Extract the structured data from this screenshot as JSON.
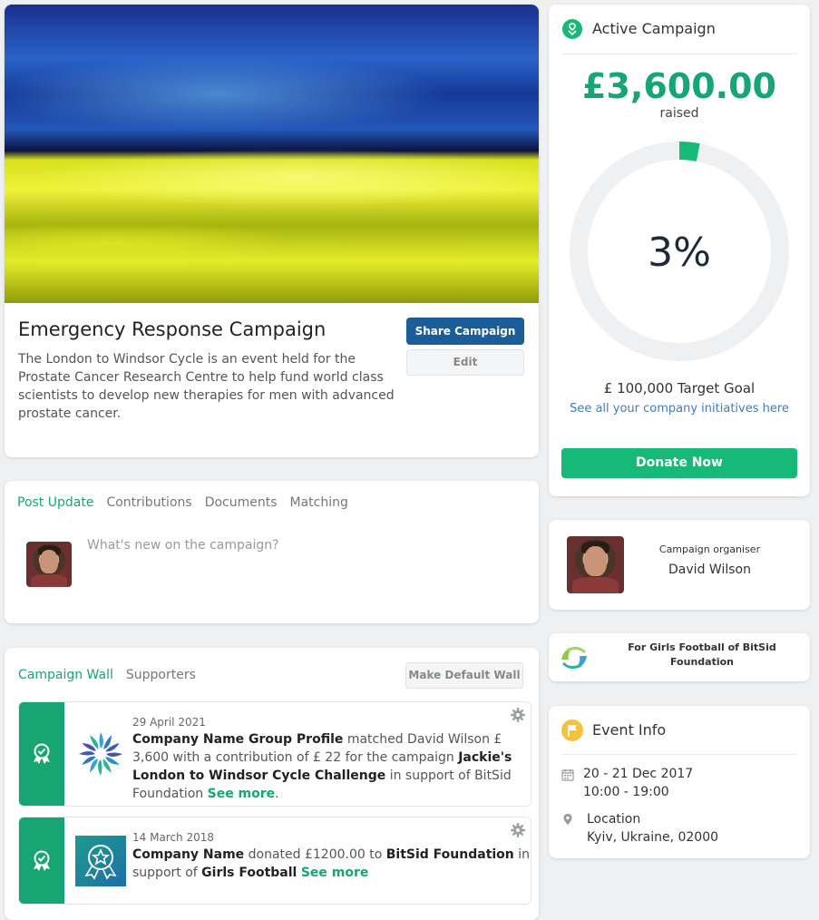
{
  "campaign": {
    "title": "Emergency Response Campaign",
    "description": "The London to Windsor Cycle is an event held for the Prostate Cancer Research Centre to help fund world class scientists to develop new therapies for men with advanced prostate cancer.",
    "share_label": "Share Campaign",
    "edit_label": "Edit"
  },
  "post": {
    "tabs": [
      "Post Update",
      "Contributions",
      "Documents",
      "Matching"
    ],
    "active_tab": "Post Update",
    "placeholder": "What's new on the campaign?"
  },
  "wall": {
    "tabs": [
      "Campaign Wall",
      "Supporters"
    ],
    "make_default_label": "Make Default Wall",
    "items": [
      {
        "date": "29 April 2021",
        "actor": "Company Name Group Profile",
        "t1": " matched David Wilson £ 3,600 with a contribution of £ 22 for the campaign ",
        "campaign": "Jackie's London to Windsor Cycle Challenge",
        "t2": " in support of BitSid Foundation ",
        "see_more": "See more",
        "t3": "."
      },
      {
        "date": "14 March 2018",
        "actor": "Company Name",
        "t1": " donated £1200.00 to ",
        "org": "BitSid Foundation",
        "t2": " in support of ",
        "cause": "Girls Football",
        "see_more": "See more"
      }
    ]
  },
  "active_campaign": {
    "title": "Active Campaign",
    "amount": "£3,600.00",
    "raised_label": "raised",
    "percent_label": "3%",
    "progress_fraction": 0.03,
    "target": "£ 100,000 Target Goal",
    "see_all": "See all your company initiatives here",
    "donate_label": "Donate Now"
  },
  "organiser": {
    "label": "Campaign organiser",
    "name": "David Wilson"
  },
  "foundation": {
    "name": "For Girls Football of BitSid Foundation"
  },
  "event": {
    "title": "Event Info",
    "dates": "20 - 21 Dec 2017",
    "times": "10:00 - 19:00",
    "location_label": "Location",
    "location": "Kyiv, Ukraine, 02000"
  },
  "colors": {
    "accent": "#17a673",
    "primary_button": "#1a5d99",
    "link": "#3a7fc1",
    "event_icon": "#f6c23e"
  }
}
